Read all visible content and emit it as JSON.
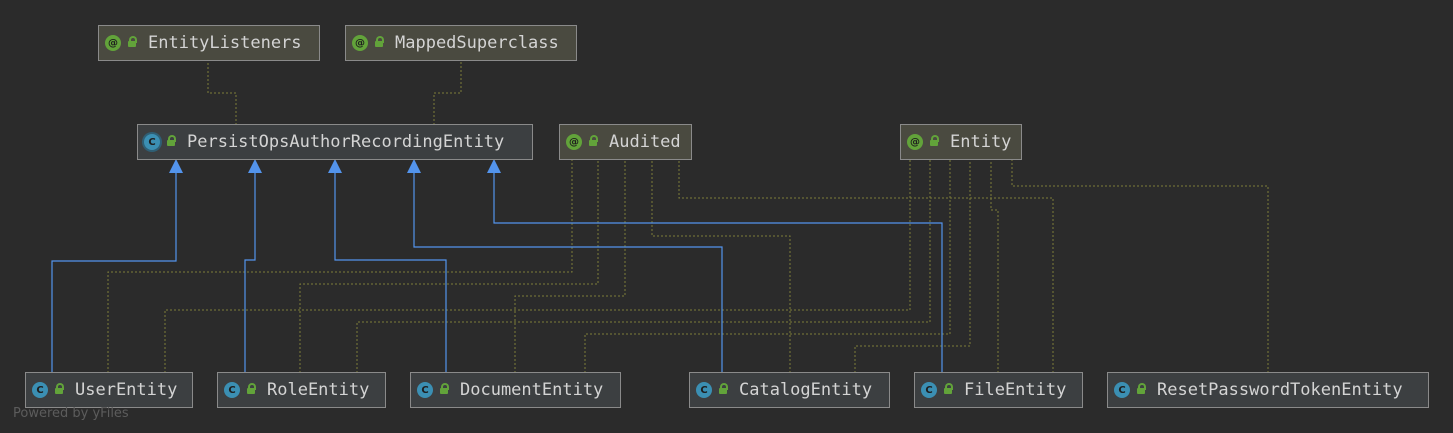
{
  "diagram": {
    "nodes": {
      "entity_listeners": {
        "label": "EntityListeners",
        "kind": "annotation",
        "icon": "annotation-icon"
      },
      "mapped_superclass": {
        "label": "MappedSuperclass",
        "kind": "annotation",
        "icon": "annotation-icon"
      },
      "persist_ops": {
        "label": "PersistOpsAuthorRecordingEntity",
        "kind": "abstract-class",
        "icon": "abstract-class-icon"
      },
      "audited": {
        "label": "Audited",
        "kind": "annotation",
        "icon": "annotation-icon"
      },
      "entity": {
        "label": "Entity",
        "kind": "annotation",
        "icon": "annotation-icon"
      },
      "user_entity": {
        "label": "UserEntity",
        "kind": "class",
        "icon": "class-icon"
      },
      "role_entity": {
        "label": "RoleEntity",
        "kind": "class",
        "icon": "class-icon"
      },
      "document_entity": {
        "label": "DocumentEntity",
        "kind": "class",
        "icon": "class-icon"
      },
      "catalog_entity": {
        "label": "CatalogEntity",
        "kind": "class",
        "icon": "class-icon"
      },
      "file_entity": {
        "label": "FileEntity",
        "kind": "class",
        "icon": "class-icon"
      },
      "reset_password_token_entity": {
        "label": "ResetPasswordTokenEntity",
        "kind": "class",
        "icon": "class-icon"
      }
    },
    "inheritance": [
      {
        "from": "user_entity",
        "to": "persist_ops"
      },
      {
        "from": "role_entity",
        "to": "persist_ops"
      },
      {
        "from": "document_entity",
        "to": "persist_ops"
      },
      {
        "from": "catalog_entity",
        "to": "persist_ops"
      },
      {
        "from": "file_entity",
        "to": "persist_ops"
      }
    ],
    "annotated_by": [
      {
        "from": "persist_ops",
        "to": "entity_listeners"
      },
      {
        "from": "persist_ops",
        "to": "mapped_superclass"
      },
      {
        "from": "user_entity",
        "to": "audited"
      },
      {
        "from": "role_entity",
        "to": "audited"
      },
      {
        "from": "document_entity",
        "to": "audited"
      },
      {
        "from": "catalog_entity",
        "to": "audited"
      },
      {
        "from": "file_entity",
        "to": "audited"
      },
      {
        "from": "user_entity",
        "to": "entity"
      },
      {
        "from": "role_entity",
        "to": "entity"
      },
      {
        "from": "document_entity",
        "to": "entity"
      },
      {
        "from": "catalog_entity",
        "to": "entity"
      },
      {
        "from": "file_entity",
        "to": "entity"
      },
      {
        "from": "reset_password_token_entity",
        "to": "entity"
      }
    ],
    "colors": {
      "inheritance": "#5394ec",
      "annotation_link": "#7d7d3a",
      "annotation_badge": "#62a33a",
      "class_badge": "#3b8fb3"
    }
  },
  "footer": "Powered by yFiles"
}
